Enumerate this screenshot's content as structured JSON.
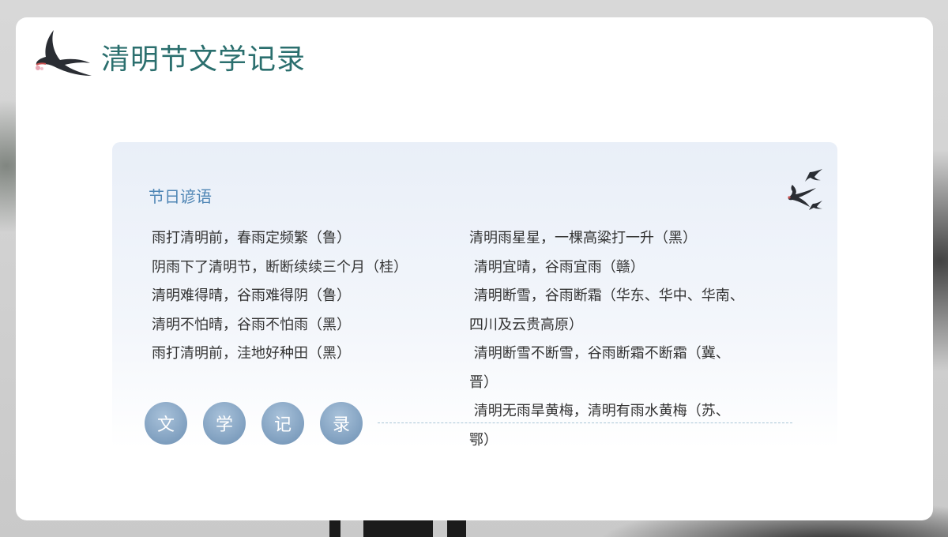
{
  "header": {
    "title": "清明节文学记录"
  },
  "section": {
    "title": "节日谚语",
    "left_lines": [
      "雨打清明前，春雨定频繁（鲁）",
      "阴雨下了清明节，断断续续三个月（桂）",
      "清明难得晴，谷雨难得阴（鲁）",
      "清明不怕晴，谷雨不怕雨（黑）",
      "雨打清明前，洼地好种田（黑）"
    ],
    "right_lines": [
      "清明雨星星，一棵高粱打一升（黑）",
      " 清明宜晴，谷雨宜雨（赣）",
      " 清明断雪，谷雨断霜（华东、华中、华南、",
      "四川及云贵高原）",
      " 清明断雪不断雪，谷雨断霜不断霜（冀、",
      "晋）",
      " 清明无雨旱黄梅，清明有雨水黄梅（苏、",
      "鄂）"
    ]
  },
  "badges": [
    "文",
    "学",
    "记",
    "录"
  ],
  "colors": {
    "title": "#2b6f6e",
    "section_title": "#4f86b5",
    "body_text": "#333333",
    "badge": "#7f9fbf"
  },
  "icons": [
    "swallow-icon",
    "swallows-icon"
  ]
}
